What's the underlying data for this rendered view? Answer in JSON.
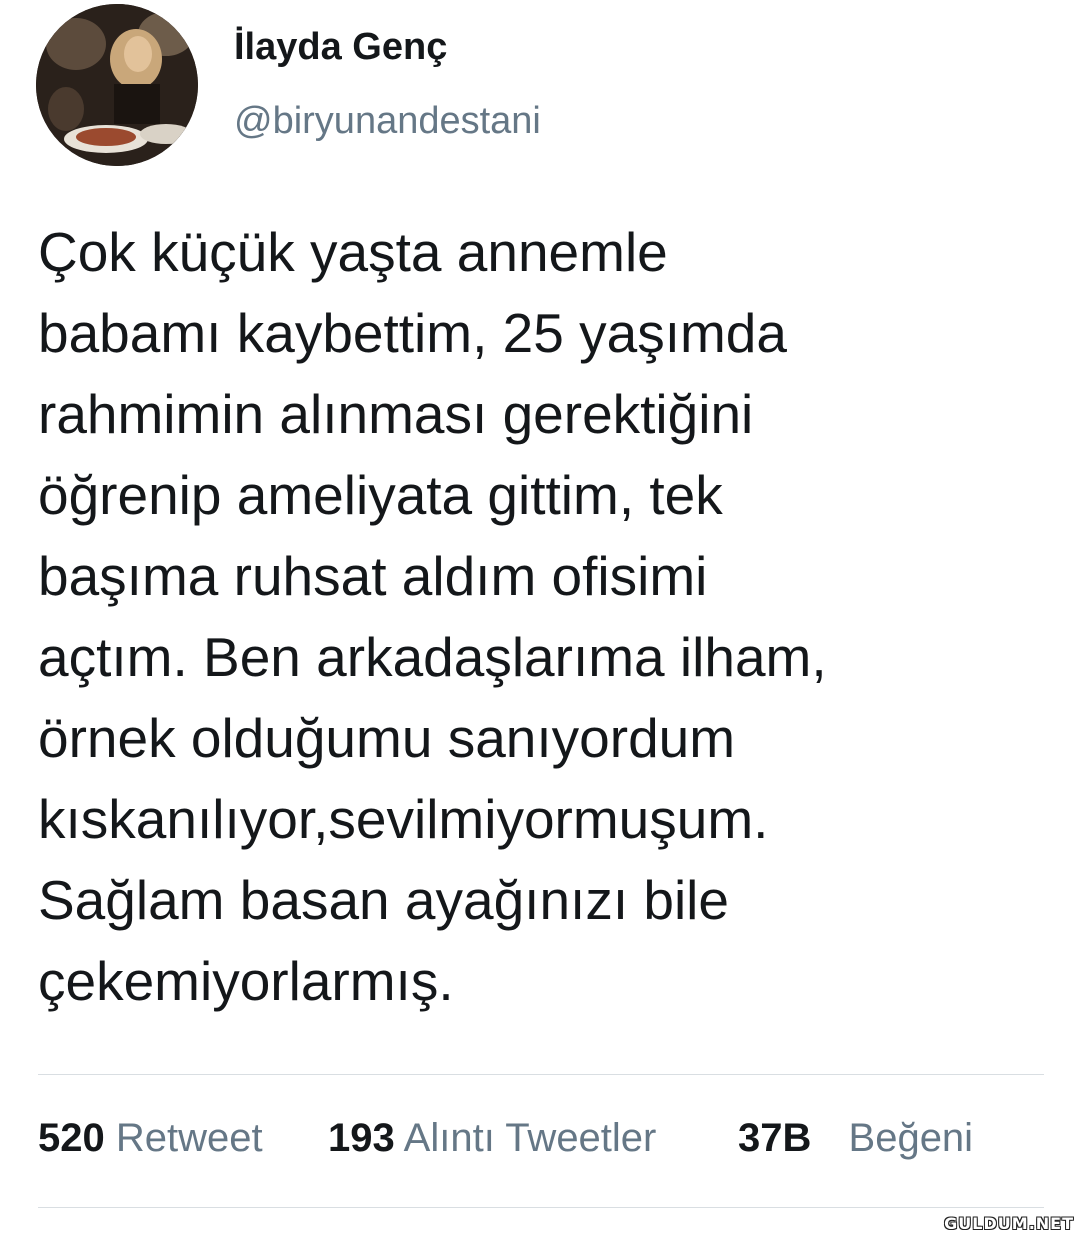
{
  "user": {
    "display_name": "İlayda Genç",
    "handle": "@biryunandestani"
  },
  "tweet": {
    "lines": [
      "Çok küçük yaşta annemle",
      "babamı kaybettim, 25 yaşımda",
      "rahmimin alınması gerektiğini",
      "öğrenip ameliyata gittim, tek",
      "başıma ruhsat aldım ofisimi",
      "açtım. Ben arkadaşlarıma ilham,",
      "örnek olduğumu sanıyordum",
      "kıskanılıyor,sevilmiyormuşum.",
      "Sağlam basan ayağınızı bile",
      "çekemiyorlarmış."
    ]
  },
  "stats": {
    "retweets": {
      "count": "520",
      "label": "Retweet"
    },
    "quotes": {
      "count": "193",
      "label": "Alıntı Tweetler"
    },
    "likes": {
      "count": "37B",
      "label": "Beğeni"
    }
  },
  "watermark": "GULDUM.NET",
  "colors": {
    "text": "#14171a",
    "secondary": "#657786",
    "divider": "#d9dee2"
  }
}
